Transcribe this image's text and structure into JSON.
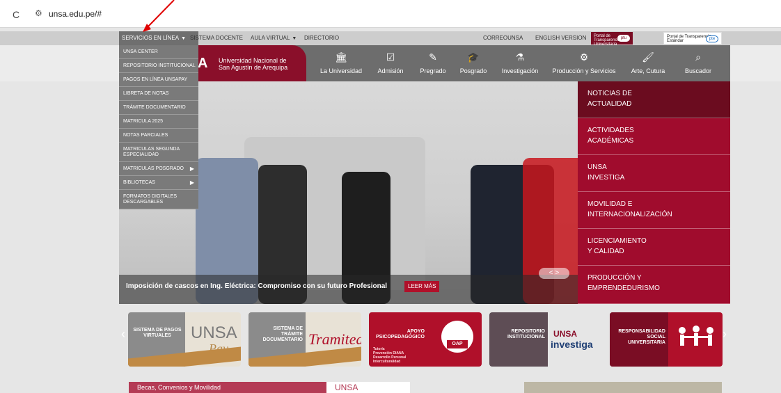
{
  "browser": {
    "url": "unsa.edu.pe/#"
  },
  "topbar": {
    "items": [
      "SERVICIOS EN LÍNEA",
      "SISTEMA DOCENTE",
      "AULA VIRTUAL",
      "DIRECTORIO",
      "CORREOUNSA",
      "ENGLISH VERSION"
    ],
    "transparency_uni_label": "Portal de Transparencia Universitaria",
    "transparency_uni_badge": "ptu",
    "transparency_std_label": "Portal de Transparencia Estándar",
    "transparency_std_badge": "pte"
  },
  "header": {
    "logo_letter": "A",
    "logo_text_line1": "Universidad Nacional de",
    "logo_text_line2": "San Agustín de Arequipa",
    "nav": [
      {
        "label": "La Universidad",
        "icon": "university-icon"
      },
      {
        "label": "Admisión",
        "icon": "checkbox-icon"
      },
      {
        "label": "Pregrado",
        "icon": "edit-icon"
      },
      {
        "label": "Posgrado",
        "icon": "graduation-cap-icon"
      },
      {
        "label": "Investigación",
        "icon": "flask-icon"
      },
      {
        "label": "Producción y Servicios",
        "icon": "gears-icon"
      },
      {
        "label": "Arte, Cutura",
        "icon": "brush-icon"
      },
      {
        "label": "Buscador",
        "icon": "search-icon"
      }
    ]
  },
  "dropdown": {
    "items": [
      "UNSA CENTER",
      "REPOSITORIO INSTITUCIONAL",
      "PAGOS EN LÍNEA UNSAPAY",
      "LIBRETA DE NOTAS",
      "TRÁMITE DOCUMENTARIO",
      "MATRICULA 2025",
      "NOTAS PARCIALES",
      "MATRICULAS SEGUNDA ESPECIALIDAD",
      "MATRICULAS POSGRADO",
      "BIBLIOTECAS",
      "FORMATOS DIGITALES DESCARGABLES"
    ]
  },
  "hero": {
    "caption": "Imposición de cascos en Ing. Eléctrica: Compromiso con su futuro Profesional",
    "more_label": "LEER MÁS",
    "slider_arrows": "<  >"
  },
  "side_menu": {
    "items": [
      [
        "NOTICIAS DE",
        "ACTUALIDAD"
      ],
      [
        "ACTIVIDADES",
        "ACADÉMICAS"
      ],
      [
        "UNSA",
        "INVESTIGA"
      ],
      [
        "MOVILIDAD E",
        "INTERNACIONALIZACIÓN"
      ],
      [
        "LICENCIAMIENTO",
        "Y CALIDAD"
      ],
      [
        "PRODUCCIÓN Y",
        "EMPRENDEDURISMO"
      ]
    ]
  },
  "banners": {
    "prev_arrow": "‹",
    "next_arrow": "›",
    "card1": {
      "line1": "SISTEMA DE PAGOS",
      "line2": "VIRTUALES",
      "brand": "UNSA",
      "brand2": "Pay"
    },
    "card2": {
      "line1": "SISTEMA DE",
      "line2": "TRÁMITE",
      "line3": "DOCUMENTARIO",
      "brand": "Tramited"
    },
    "card3": {
      "line1": "APOYO",
      "line2": "PSICOPEDAGÓGICO",
      "sub1": "Tutoría",
      "sub2": "Prevención DIANA",
      "sub3": "Desarrollo Personal",
      "sub4": "Interculturalidad",
      "brand": "OAP"
    },
    "card4": {
      "line1": "REPOSITORIO",
      "line2": "INSTITUCIONAL",
      "brand": "UNSA",
      "brand2": "investiga"
    },
    "card5": {
      "line1": "RESPONSABILIDAD",
      "line2": "SOCIAL",
      "line3": "UNIVERSITARIA"
    }
  },
  "bottom": {
    "panel1": "Becas, Convenios y Movilidad",
    "panel2": "UNSA"
  },
  "colors": {
    "brand_red": "#a00c2d",
    "dark_red": "#6b0c1f"
  }
}
